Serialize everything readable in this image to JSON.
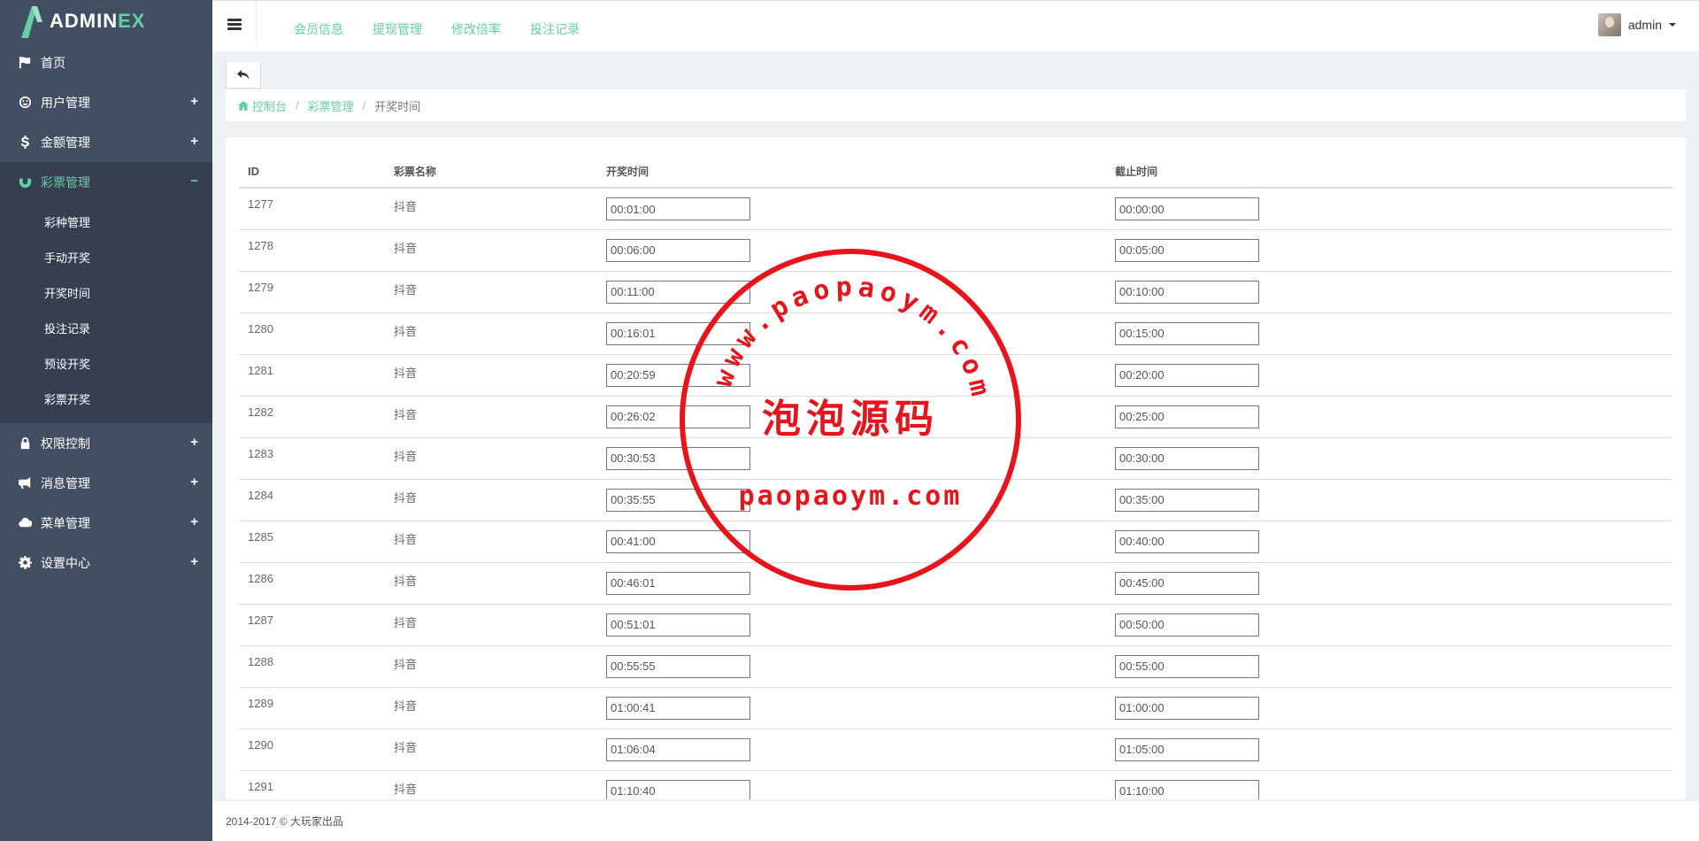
{
  "brand": {
    "prefix": "ADMIN",
    "suffix": "EX"
  },
  "sidebar": {
    "items": [
      {
        "label": "首页",
        "icon": "flag-icon",
        "expandable": false
      },
      {
        "label": "用户管理",
        "icon": "smile-icon",
        "expandable": true,
        "toggle": "+"
      },
      {
        "label": "金额管理",
        "icon": "dollar-icon",
        "expandable": true,
        "toggle": "+"
      },
      {
        "label": "彩票管理",
        "icon": "magnet-icon",
        "expandable": true,
        "toggle": "−",
        "active": true,
        "children": [
          "彩种管理",
          "手动开奖",
          "开奖时间",
          "投注记录",
          "预设开奖",
          "彩票开奖"
        ]
      },
      {
        "label": "权限控制",
        "icon": "lock-icon",
        "expandable": true,
        "toggle": "+"
      },
      {
        "label": "消息管理",
        "icon": "bullhorn-icon",
        "expandable": true,
        "toggle": "+"
      },
      {
        "label": "菜单管理",
        "icon": "cloud-icon",
        "expandable": true,
        "toggle": "+"
      },
      {
        "label": "设置中心",
        "icon": "gear-icon",
        "expandable": true,
        "toggle": "+"
      }
    ]
  },
  "header": {
    "links": [
      "会员信息",
      "提现管理",
      "修改倍率",
      "投注记录"
    ],
    "user": "admin"
  },
  "breadcrumb": {
    "home": "控制台",
    "section": "彩票管理",
    "current": "开奖时间"
  },
  "table": {
    "columns": [
      "ID",
      "彩票名称",
      "开奖时间",
      "截止时间"
    ],
    "rows": [
      {
        "id": "1277",
        "name": "抖音",
        "open": "00:01:00",
        "close": "00:00:00"
      },
      {
        "id": "1278",
        "name": "抖音",
        "open": "00:06:00",
        "close": "00:05:00"
      },
      {
        "id": "1279",
        "name": "抖音",
        "open": "00:11:00",
        "close": "00:10:00"
      },
      {
        "id": "1280",
        "name": "抖音",
        "open": "00:16:01",
        "close": "00:15:00"
      },
      {
        "id": "1281",
        "name": "抖音",
        "open": "00:20:59",
        "close": "00:20:00"
      },
      {
        "id": "1282",
        "name": "抖音",
        "open": "00:26:02",
        "close": "00:25:00"
      },
      {
        "id": "1283",
        "name": "抖音",
        "open": "00:30:53",
        "close": "00:30:00"
      },
      {
        "id": "1284",
        "name": "抖音",
        "open": "00:35:55",
        "close": "00:35:00"
      },
      {
        "id": "1285",
        "name": "抖音",
        "open": "00:41:00",
        "close": "00:40:00"
      },
      {
        "id": "1286",
        "name": "抖音",
        "open": "00:46:01",
        "close": "00:45:00"
      },
      {
        "id": "1287",
        "name": "抖音",
        "open": "00:51:01",
        "close": "00:50:00"
      },
      {
        "id": "1288",
        "name": "抖音",
        "open": "00:55:55",
        "close": "00:55:00"
      },
      {
        "id": "1289",
        "name": "抖音",
        "open": "01:00:41",
        "close": "01:00:00"
      },
      {
        "id": "1290",
        "name": "抖音",
        "open": "01:06:04",
        "close": "01:05:00"
      },
      {
        "id": "1291",
        "name": "抖音",
        "open": "01:10:40",
        "close": "01:10:00"
      }
    ]
  },
  "watermark": {
    "arc_text": "www.paopaoym.com",
    "center_text": "泡泡源码",
    "bottom_text": "paopaoym.com",
    "color": "#e8141b"
  },
  "footer": {
    "text": "2014-2017 © 大玩家出品"
  },
  "colors": {
    "accent": "#65cea7",
    "sidebar_bg": "#424f63",
    "sidebar_active_bg": "#353f4f"
  }
}
